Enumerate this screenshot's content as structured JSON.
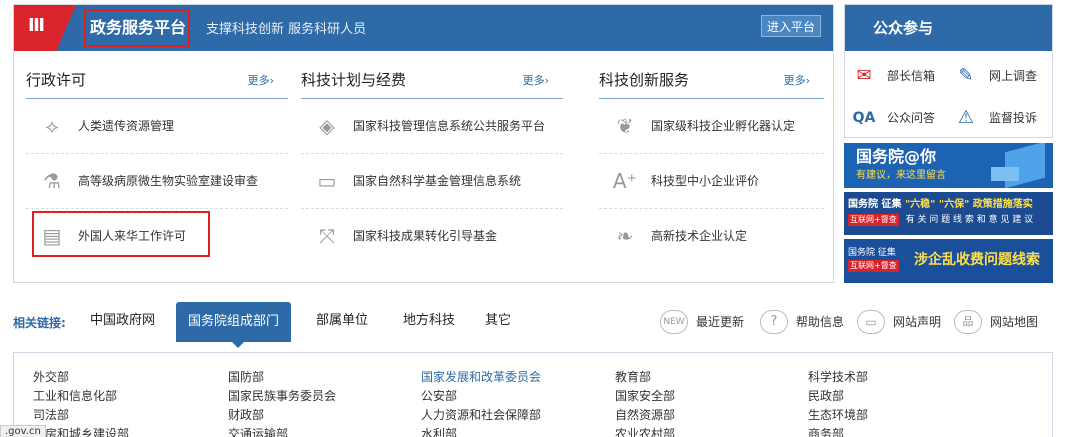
{
  "header": {
    "emblem_glyph": "Ⅲ",
    "title": "政务服务平台",
    "subtitle": "支撑科技创新 服务科研人员",
    "enter_label": "进入平台"
  },
  "columns": [
    {
      "title": "行政许可",
      "more": "更多›",
      "items": [
        {
          "label": "人类遗传资源管理",
          "icon": "dna-icon"
        },
        {
          "label": "高等级病原微生物实验室建设审查",
          "icon": "flask-icon"
        },
        {
          "label": "外国人来华工作许可",
          "icon": "id-card-icon"
        }
      ]
    },
    {
      "title": "科技计划与经费",
      "more": "更多›",
      "items": [
        {
          "label": "国家科技管理信息系统公共服务平台",
          "icon": "diamond-icon"
        },
        {
          "label": "国家自然科学基金管理信息系统",
          "icon": "computer-icon"
        },
        {
          "label": "国家科技成果转化引导基金",
          "icon": "transfer-icon"
        }
      ]
    },
    {
      "title": "科技创新服务",
      "more": "更多›",
      "items": [
        {
          "label": "国家级科技企业孵化器认定",
          "icon": "sprout-icon"
        },
        {
          "label": "科技型中小企业评价",
          "icon": "grade-icon"
        },
        {
          "label": "高新技术企业认定",
          "icon": "leaf-icon"
        }
      ]
    }
  ],
  "public": {
    "title": "公众参与",
    "items": [
      {
        "label": "部长信箱",
        "icon": "mail-icon"
      },
      {
        "label": "网上调查",
        "icon": "survey-icon"
      },
      {
        "label": "公众问答",
        "icon": "qa-icon"
      },
      {
        "label": "监督投诉",
        "icon": "warning-icon"
      }
    ]
  },
  "banners": {
    "b1_title": "国务院@你",
    "b1_sub": "有建议，来这里留言",
    "b2_line1_a": "国务院 征集",
    "b2_line1_b": "\"六稳\" \"六保\" 政策措施落实",
    "b2_tag": "互联网+督查",
    "b2_line2": "有 关 问 题 线 索 和 意 见 建 议",
    "b3_line1": "国务院 征集",
    "b3_tag": "互联网+督查",
    "b3_main": "涉企乱收费问题线索"
  },
  "links": {
    "label": "相关链接:",
    "tabs": [
      "中国政府网",
      "国务院组成部门",
      "部属单位",
      "地方科技",
      "其它"
    ],
    "utilities": [
      {
        "label": "最近更新",
        "icon_text": "NEW"
      },
      {
        "label": "帮助信息",
        "icon_text": "?"
      },
      {
        "label": "网站声明",
        "icon_text": "▭"
      },
      {
        "label": "网站地图",
        "icon_text": "品"
      }
    ]
  },
  "departments": [
    [
      "外交部",
      "工业和信息化部",
      "司法部",
      "住房和城乡建设部"
    ],
    [
      "国防部",
      "国家民族事务委员会",
      "财政部",
      "交通运输部"
    ],
    [
      "国家发展和改革委员会",
      "公安部",
      "人力资源和社会保障部",
      "水利部"
    ],
    [
      "教育部",
      "国家安全部",
      "自然资源部",
      "农业农村部"
    ],
    [
      "科学技术部",
      "民政部",
      "生态环境部",
      "商务部"
    ]
  ],
  "status_url": ".gov.cn"
}
